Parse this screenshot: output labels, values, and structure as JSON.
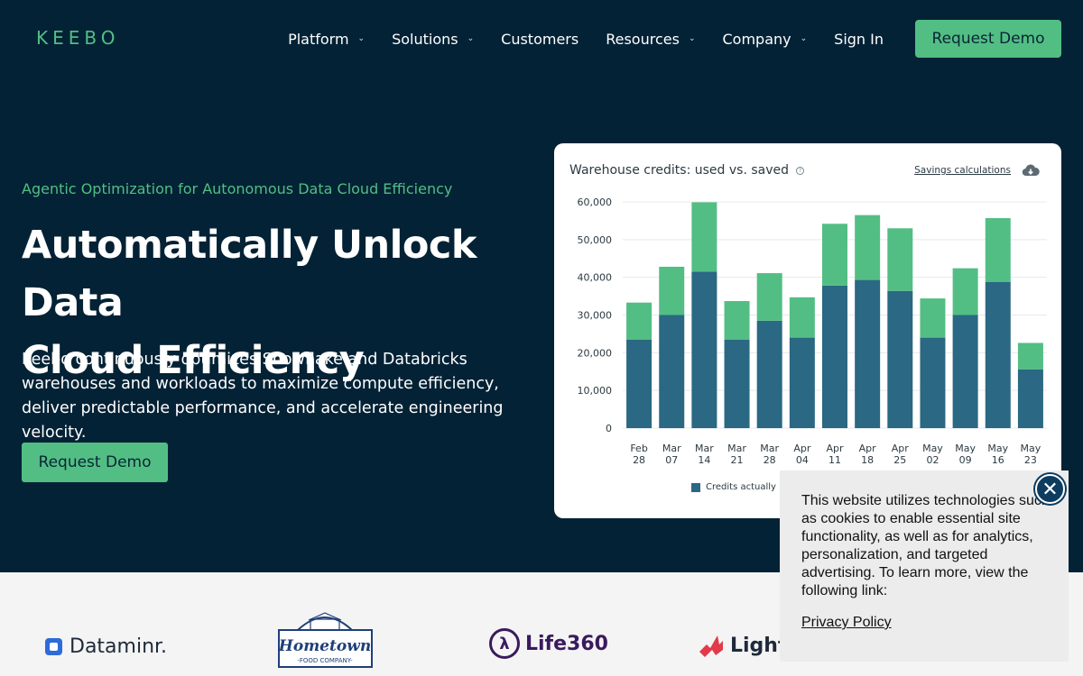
{
  "brand": {
    "logo_text": "KEEBO",
    "accent": "#52be84",
    "dark": "#032235"
  },
  "nav": {
    "items": [
      {
        "label": "Platform",
        "dropdown": true
      },
      {
        "label": "Solutions",
        "dropdown": true
      },
      {
        "label": "Customers",
        "dropdown": false
      },
      {
        "label": "Resources",
        "dropdown": true
      },
      {
        "label": "Company",
        "dropdown": true
      }
    ],
    "signin": "Sign In",
    "cta": "Request Demo"
  },
  "hero": {
    "eyebrow": "Agentic Optimization for Autonomous Data Cloud Efficiency",
    "headline_line1": "Automatically Unlock Data",
    "headline_line2": "Cloud Efficiency",
    "subcopy": "Keebo continuously optimizes Snowflake and Databricks warehouses and workloads to maximize compute efficiency, deliver predictable performance, and accelerate engineering velocity.",
    "cta": "Request Demo"
  },
  "chart_card": {
    "title": "Warehouse credits: used vs. saved",
    "link": "Savings calculations",
    "legend_used": "Credits actually us"
  },
  "chart_data": {
    "type": "bar",
    "stacked": true,
    "categories": [
      "Feb 28",
      "Mar 07",
      "Mar 14",
      "Mar 21",
      "Mar 28",
      "Apr 04",
      "Apr 11",
      "Apr 18",
      "Apr 25",
      "May 02",
      "May 09",
      "May 16",
      "May 23"
    ],
    "series": [
      {
        "name": "Credits actually us",
        "color": "#2a6883",
        "values": [
          23500,
          30000,
          41500,
          23500,
          28500,
          24000,
          37800,
          39300,
          36400,
          24000,
          30000,
          38800,
          15600
        ]
      },
      {
        "color": "#52be84",
        "values": [
          9800,
          12800,
          18400,
          10200,
          12600,
          10700,
          16400,
          17200,
          16600,
          10400,
          12400,
          16900,
          7000
        ]
      }
    ],
    "yticks": [
      "60,000",
      "50,000",
      "40,000",
      "30,000",
      "20,000",
      "10,000",
      "0"
    ],
    "ylim": [
      0,
      60000
    ],
    "grid": true
  },
  "logos": {
    "dataminr": "Dataminr.",
    "hometown_line1": "Hometown",
    "hometown_line2": "-FOOD COMPANY-",
    "life360": "Life360",
    "lightx": "Lighte"
  },
  "cookie": {
    "text": "This website utilizes technologies such as cookies to enable essential site functionality, as well as for analytics, personalization, and targeted advertising. To learn more, view the following link:",
    "link": "Privacy Policy"
  }
}
